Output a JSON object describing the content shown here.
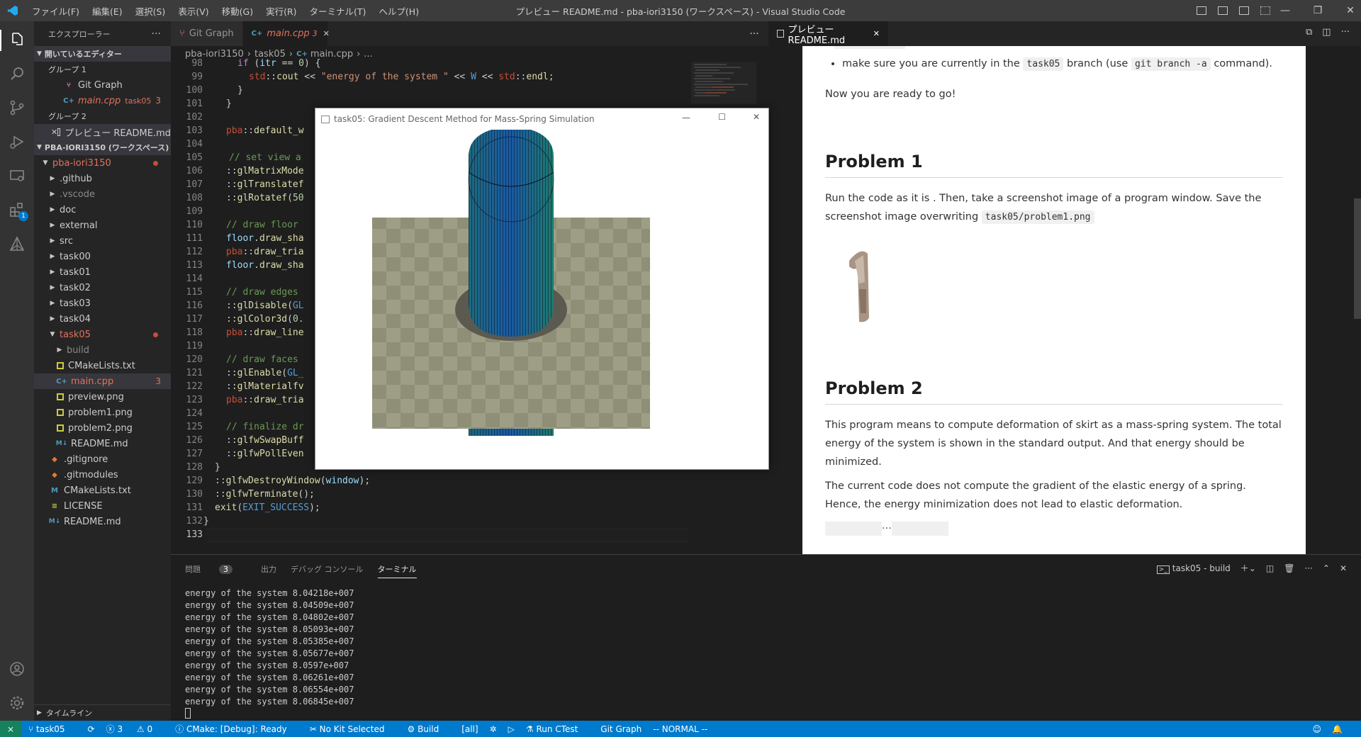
{
  "titlebar": {
    "menu": [
      "ファイル(F)",
      "編集(E)",
      "選択(S)",
      "表示(V)",
      "移動(G)",
      "実行(R)",
      "ターミナル(T)",
      "ヘルプ(H)"
    ],
    "title": "プレビュー README.md - pba-iori3150 (ワークスペース) - Visual Studio Code"
  },
  "sidebar": {
    "header": "エクスプローラー",
    "open_editors_label": "開いているエディター",
    "group1": "グループ 1",
    "group2": "グループ 2",
    "open_items": [
      {
        "label": "Git Graph"
      },
      {
        "label": "main.cpp",
        "folder": "task05",
        "count": "3"
      },
      {
        "label": "プレビュー README.md"
      }
    ],
    "workspace_label": "PBA-IORI3150 (ワークスペース)",
    "root": "pba-iori3150",
    "folders": [
      ".github",
      ".vscode",
      "doc",
      "external",
      "src",
      "task00",
      "task01",
      "task02",
      "task03",
      "task04",
      "task05"
    ],
    "task05_items": [
      "build",
      "CMakeLists.txt",
      "main.cpp",
      "preview.png",
      "problem1.png",
      "problem2.png",
      "README.md"
    ],
    "main_count": "3",
    "root_files": [
      ".gitignore",
      ".gitmodules",
      "CMakeLists.txt",
      "LICENSE",
      "README.md"
    ],
    "timeline": "タイムライン"
  },
  "editor": {
    "tabs": [
      {
        "label": "Git Graph"
      },
      {
        "label": "main.cpp",
        "count": "3"
      }
    ],
    "breadcrumb": [
      "pba-iori3150",
      "task05",
      "main.cpp",
      "..."
    ],
    "line_numbers": [
      "98",
      "99",
      "100",
      "101",
      "102",
      "103",
      "104",
      "105",
      "106",
      "107",
      "108",
      "109",
      "110",
      "111",
      "112",
      "113",
      "114",
      "115",
      "116",
      "117",
      "118",
      "119",
      "120",
      "121",
      "122",
      "123",
      "124",
      "125",
      "126",
      "127",
      "128",
      "129",
      "130",
      "131",
      "132",
      "133"
    ]
  },
  "glwindow": {
    "title": "task05: Gradient Descent Method for Mass-Spring Simulation",
    "colors": {
      "floor": "#9e9e86",
      "check": "#8a8a74",
      "cylinder_a": "#1a5aa6",
      "cylinder_b": "#1e7a6e",
      "skirt": "#5a5a50"
    }
  },
  "preview": {
    "tab": "プレビュー README.md",
    "bullet": {
      "pre": "make sure you are currently in the",
      "code1": "task05",
      "mid": "branch (use",
      "code2": "git branch -a",
      "post": "command)."
    },
    "ready": "Now you are ready to go!",
    "p1_title": "Problem 1",
    "p1_text_a": "Run the code as it is . Then, take a screenshot image of a program window. Save the screenshot image overwriting",
    "p1_code": "task05/problem1.png",
    "p2_title": "Problem 2",
    "p2_text1": "This program means to compute deformation of skirt as a mass-spring system. The total energy of the system is shown in the standard output. And that energy should be minimized.",
    "p2_text2": "The current code does not compute the gradient of the elastic energy of a spring. Hence, the energy minimization does not lead to elastic deformation."
  },
  "panel": {
    "tabs": [
      "問題",
      "出力",
      "デバッグ コンソール",
      "ターミナル"
    ],
    "problems_count": "3",
    "terminal_name": "task05 - build",
    "terminal_lines": [
      "energy of the system 8.04218e+007",
      "energy of the system 8.04509e+007",
      "energy of the system 8.04802e+007",
      "energy of the system 8.05093e+007",
      "energy of the system 8.05385e+007",
      "energy of the system 8.05677e+007",
      "energy of the system 8.0597e+007",
      "energy of the system 8.06261e+007",
      "energy of the system 8.06554e+007",
      "energy of the system 8.06845e+007"
    ]
  },
  "statusbar": {
    "branch": "task05",
    "errors": "3",
    "warnings": "0",
    "cmake": "CMake: [Debug]: Ready",
    "kit": "No Kit Selected",
    "build": "Build",
    "target": "[all]",
    "ctest": "Run CTest",
    "gitgraph": "Git Graph",
    "mode": "-- NORMAL --"
  }
}
